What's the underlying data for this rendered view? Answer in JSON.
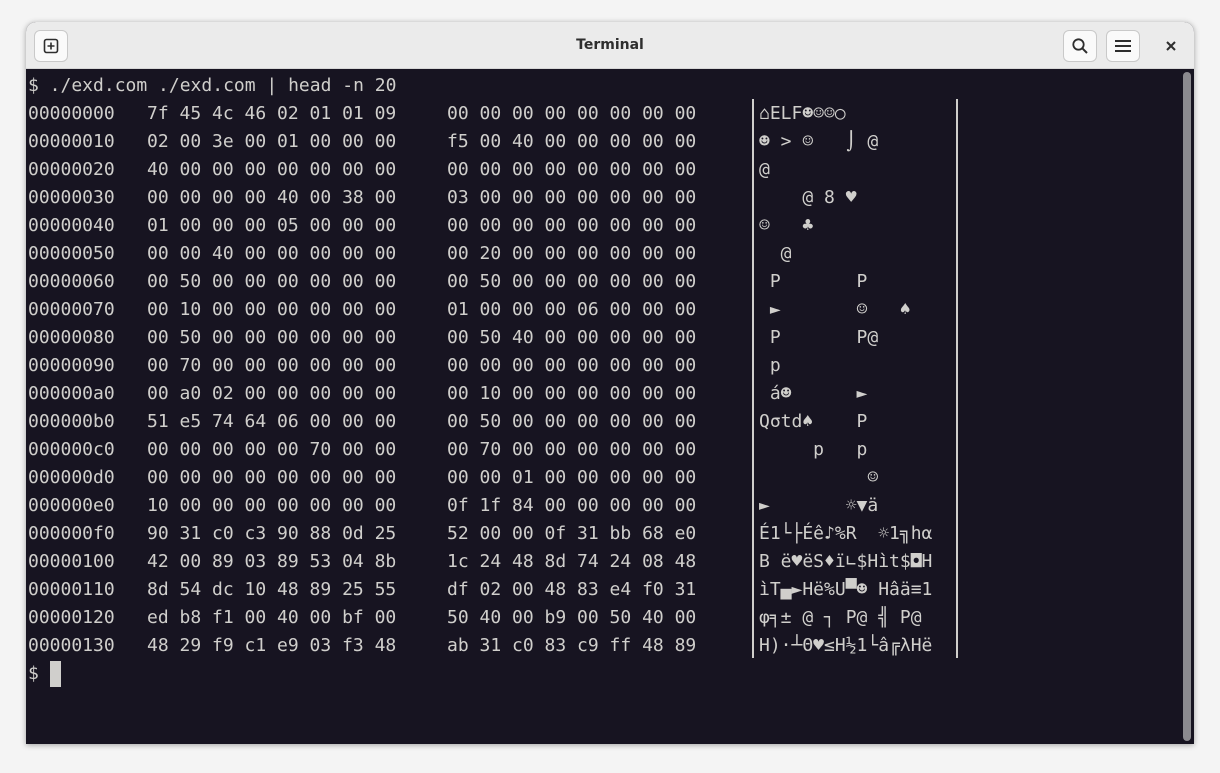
{
  "window": {
    "title": "Terminal",
    "icons": {
      "new_tab": "new-tab-icon",
      "search": "search-icon",
      "menu": "hamburger-menu-icon",
      "close": "close-icon"
    },
    "colors": {
      "terminal_bg": "#171421",
      "terminal_fg": "#d0cfcc",
      "titlebar_bg": "#ebebeb"
    }
  },
  "terminal": {
    "command_line": "$ ./exd.com ./exd.com | head -n 20",
    "prompt": "$ ",
    "rows": [
      {
        "offset": "00000000",
        "hex1": "7f 45 4c 46 02 01 01 09",
        "hex2": "00 00 00 00 00 00 00 00",
        "ascii": "⌂ELF☻☺☺○"
      },
      {
        "offset": "00000010",
        "hex1": "02 00 3e 00 01 00 00 00",
        "hex2": "f5 00 40 00 00 00 00 00",
        "ascii": "☻ > ☺   ⌡ @     "
      },
      {
        "offset": "00000020",
        "hex1": "40 00 00 00 00 00 00 00",
        "hex2": "00 00 00 00 00 00 00 00",
        "ascii": "@               "
      },
      {
        "offset": "00000030",
        "hex1": "00 00 00 00 40 00 38 00",
        "hex2": "03 00 00 00 00 00 00 00",
        "ascii": "    @ 8 ♥       "
      },
      {
        "offset": "00000040",
        "hex1": "01 00 00 00 05 00 00 00",
        "hex2": "00 00 00 00 00 00 00 00",
        "ascii": "☺   ♣           "
      },
      {
        "offset": "00000050",
        "hex1": "00 00 40 00 00 00 00 00",
        "hex2": "00 20 00 00 00 00 00 00",
        "ascii": "  @             "
      },
      {
        "offset": "00000060",
        "hex1": "00 50 00 00 00 00 00 00",
        "hex2": "00 50 00 00 00 00 00 00",
        "ascii": " P       P      "
      },
      {
        "offset": "00000070",
        "hex1": "00 10 00 00 00 00 00 00",
        "hex2": "01 00 00 00 06 00 00 00",
        "ascii": " ►       ☺   ♠  "
      },
      {
        "offset": "00000080",
        "hex1": "00 50 00 00 00 00 00 00",
        "hex2": "00 50 40 00 00 00 00 00",
        "ascii": " P       P@     "
      },
      {
        "offset": "00000090",
        "hex1": "00 70 00 00 00 00 00 00",
        "hex2": "00 00 00 00 00 00 00 00",
        "ascii": " p              "
      },
      {
        "offset": "000000a0",
        "hex1": "00 a0 02 00 00 00 00 00",
        "hex2": "00 10 00 00 00 00 00 00",
        "ascii": " á☻      ►      "
      },
      {
        "offset": "000000b0",
        "hex1": "51 e5 74 64 06 00 00 00",
        "hex2": "00 50 00 00 00 00 00 00",
        "ascii": "Qσtd♠    P      "
      },
      {
        "offset": "000000c0",
        "hex1": "00 00 00 00 00 70 00 00",
        "hex2": "00 70 00 00 00 00 00 00",
        "ascii": "     p   p      "
      },
      {
        "offset": "000000d0",
        "hex1": "00 00 00 00 00 00 00 00",
        "hex2": "00 00 01 00 00 00 00 00",
        "ascii": "          ☺     "
      },
      {
        "offset": "000000e0",
        "hex1": "10 00 00 00 00 00 00 00",
        "hex2": "0f 1f 84 00 00 00 00 00",
        "ascii": "►       ☼▼ä     "
      },
      {
        "offset": "000000f0",
        "hex1": "90 31 c0 c3 90 88 0d 25",
        "hex2": "52 00 00 0f 31 bb 68 e0",
        "ascii": "É1└├Éê♪%R  ☼1╗hα"
      },
      {
        "offset": "00000100",
        "hex1": "42 00 89 03 89 53 04 8b",
        "hex2": "1c 24 48 8d 74 24 08 48",
        "ascii": "B ë♥ëS♦ï∟$Hìt$◘H"
      },
      {
        "offset": "00000110",
        "hex1": "8d 54 dc 10 48 89 25 55",
        "hex2": "df 02 00 48 83 e4 f0 31",
        "ascii": "ìT▄►Hë%U▀☻ Hâä≡1"
      },
      {
        "offset": "00000120",
        "hex1": "ed b8 f1 00 40 00 bf 00",
        "hex2": "50 40 00 b9 00 50 40 00",
        "ascii": "φ╕± @ ┐ P@ ╣ P@ "
      },
      {
        "offset": "00000130",
        "hex1": "48 29 f9 c1 e9 03 f3 48",
        "hex2": "ab 31 c0 83 c9 ff 48 89",
        "ascii": "H)·┴Θ♥≤H½1└â╔λHë"
      }
    ]
  }
}
